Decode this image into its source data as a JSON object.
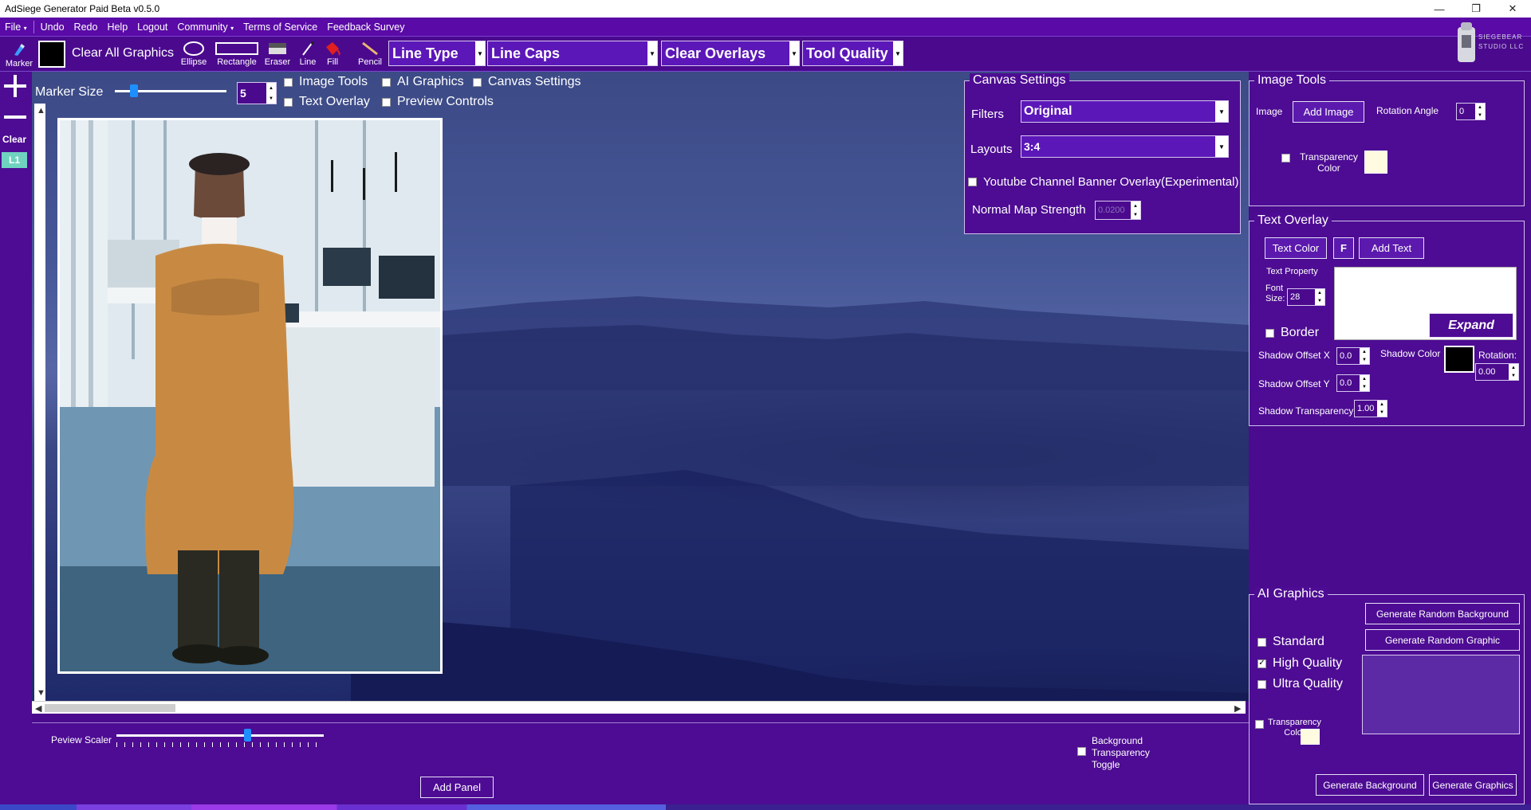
{
  "window": {
    "title": "AdSiege Generator Paid Beta v0.5.0",
    "controls": [
      "—",
      "❐",
      "✕"
    ]
  },
  "menu": {
    "file": "File",
    "items": [
      "Undo",
      "Redo",
      "Help",
      "Logout",
      "Community",
      "Terms of Service",
      "Feedback Survey"
    ]
  },
  "toolbar": {
    "marker": "Marker",
    "clear_all": "Clear All Graphics",
    "ellipse": "Ellipse",
    "rectangle": "Rectangle",
    "eraser": "Eraser",
    "line": "Line",
    "fill": "Fill",
    "pencil": "Pencil",
    "line_type": "Line Type",
    "line_caps": "Line Caps",
    "clear_overlays": "Clear Overlays",
    "tool_quality": "Tool Quality"
  },
  "leftbar": {
    "clear": "Clear",
    "layer": "L1"
  },
  "marker_size": {
    "label": "Marker Size",
    "value": "5",
    "slider_fraction": 0.17
  },
  "toggles": {
    "image_tools": "Image Tools",
    "ai_graphics": "AI Graphics",
    "canvas_settings": "Canvas Settings",
    "text_overlay": "Text Overlay",
    "preview_controls": "Preview Controls"
  },
  "canvas_settings": {
    "title": "Canvas Settings",
    "filters_label": "Filters",
    "filters_value": "Original",
    "layouts_label": "Layouts",
    "layouts_value": "3:4",
    "yt_banner": "Youtube Channel Banner Overlay(Experimental)",
    "normal_map_label": "Normal Map Strength",
    "normal_map_value": "0.0200"
  },
  "image_tools": {
    "title": "Image Tools",
    "image_label": "Image",
    "add_image": "Add Image",
    "rotation_label": "Rotation Angle",
    "rotation_value": "0",
    "transparency_label_1": "Transparency",
    "transparency_label_2": "Color",
    "transparency_color": "#fffbe0"
  },
  "text_overlay": {
    "title": "Text Overlay",
    "text_color": "Text Color",
    "font_button": "F",
    "add_text": "Add Text",
    "text_property": "Text Property",
    "font_label_1": "Font",
    "font_label_2": "Size:",
    "font_size": "28",
    "border": "Border",
    "expand": "Expand",
    "shadow_x_label": "Shadow Offset X",
    "shadow_x": "0.0",
    "shadow_y_label": "Shadow Offset Y",
    "shadow_y": "0.0",
    "shadow_color_label": "Shadow Color",
    "shadow_color": "#000000",
    "rotation_label": "Rotation:",
    "rotation": "0.00",
    "shadow_transparency_label": "Shadow Transparency",
    "shadow_transparency": "1.00"
  },
  "ai_graphics": {
    "title": "AI Graphics",
    "gen_random_bg": "Generate Random Background",
    "gen_random_graphic": "Generate Random Graphic",
    "standard": "Standard",
    "high_quality": "High Quality",
    "ultra_quality": "Ultra Quality",
    "transparency_label_1": "Transparency",
    "transparency_label_2": "Color",
    "transparency_color": "#fffbe0",
    "gen_background": "Generate Background",
    "gen_graphics": "Generate Graphics"
  },
  "bottom": {
    "preview_scaler": "Peview Scaler",
    "scaler_fraction": 0.63,
    "add_panel": "Add Panel",
    "bg_toggle_1": "Background",
    "bg_toggle_2": "Transparency",
    "bg_toggle_3": "Toggle"
  },
  "logo": {
    "text_1": "SIEGEBEAR",
    "text_2": "STUDIO LLC"
  },
  "colors": {
    "app_purple": "#4d0c93",
    "accent_blue": "#1e8fff",
    "layer_teal": "#6fd3c0"
  }
}
